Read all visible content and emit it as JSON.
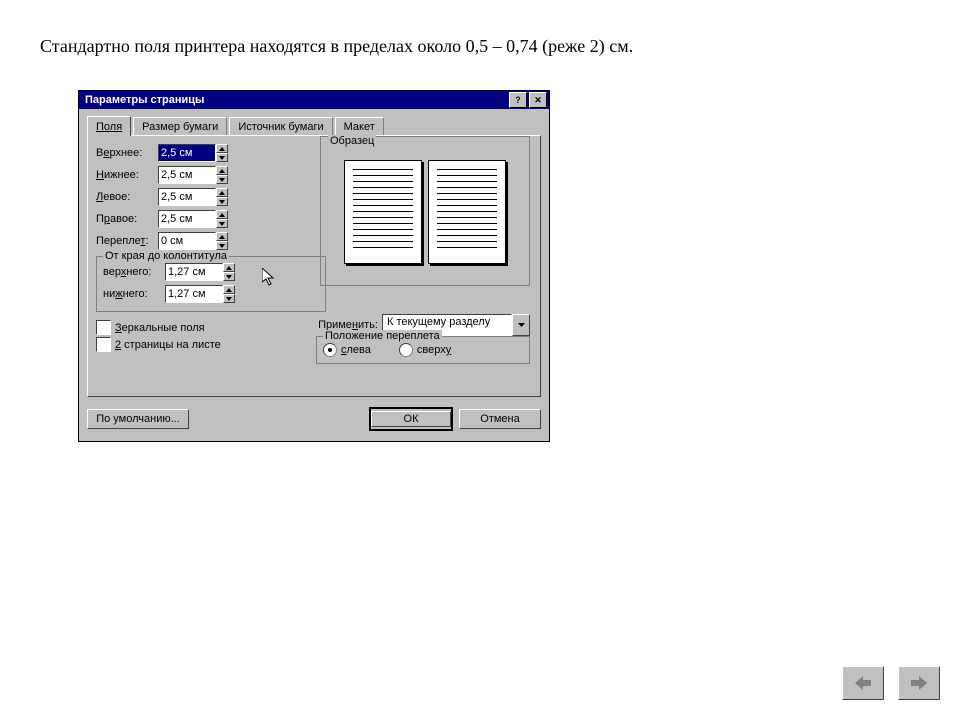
{
  "caption": "Стандартно поля принтера находятся в пределах около 0,5 – 0,74 (реже 2) см.",
  "dialog": {
    "title": "Параметры страницы",
    "tabs": [
      "Поля",
      "Размер бумаги",
      "Источник бумаги",
      "Макет"
    ],
    "activeTab": 0,
    "fields": {
      "top": {
        "label": "Верхнее:",
        "value": "2,5 см",
        "selected": true,
        "underline": 1
      },
      "bottom": {
        "label": "Нижнее:",
        "value": "2,5 см",
        "underline": 0
      },
      "left": {
        "label": "Левое:",
        "value": "2,5 см",
        "underline": 0
      },
      "right": {
        "label": "Правое:",
        "value": "2,5 см",
        "underline": 1
      },
      "gutter": {
        "label": "Переплет:",
        "value": "0 см",
        "underline": 7
      }
    },
    "headerGroup": {
      "legend": "От края до колонтитула",
      "header": {
        "label": "верхнего:",
        "value": "1,27 см"
      },
      "footer": {
        "label": "нижнего:",
        "value": "1,27 см"
      }
    },
    "checks": {
      "mirror": "Зеркальные поля",
      "twoPages": "2 страницы на листе"
    },
    "preview": {
      "legend": "Образец"
    },
    "apply": {
      "label": "Применить:",
      "value": "К текущему разделу"
    },
    "binding": {
      "legend": "Положение переплета",
      "left": "слева",
      "top": "сверху",
      "selected": "left"
    },
    "buttons": {
      "default_": "По умолчанию...",
      "ok": "ОК",
      "cancel": "Отмена"
    }
  }
}
